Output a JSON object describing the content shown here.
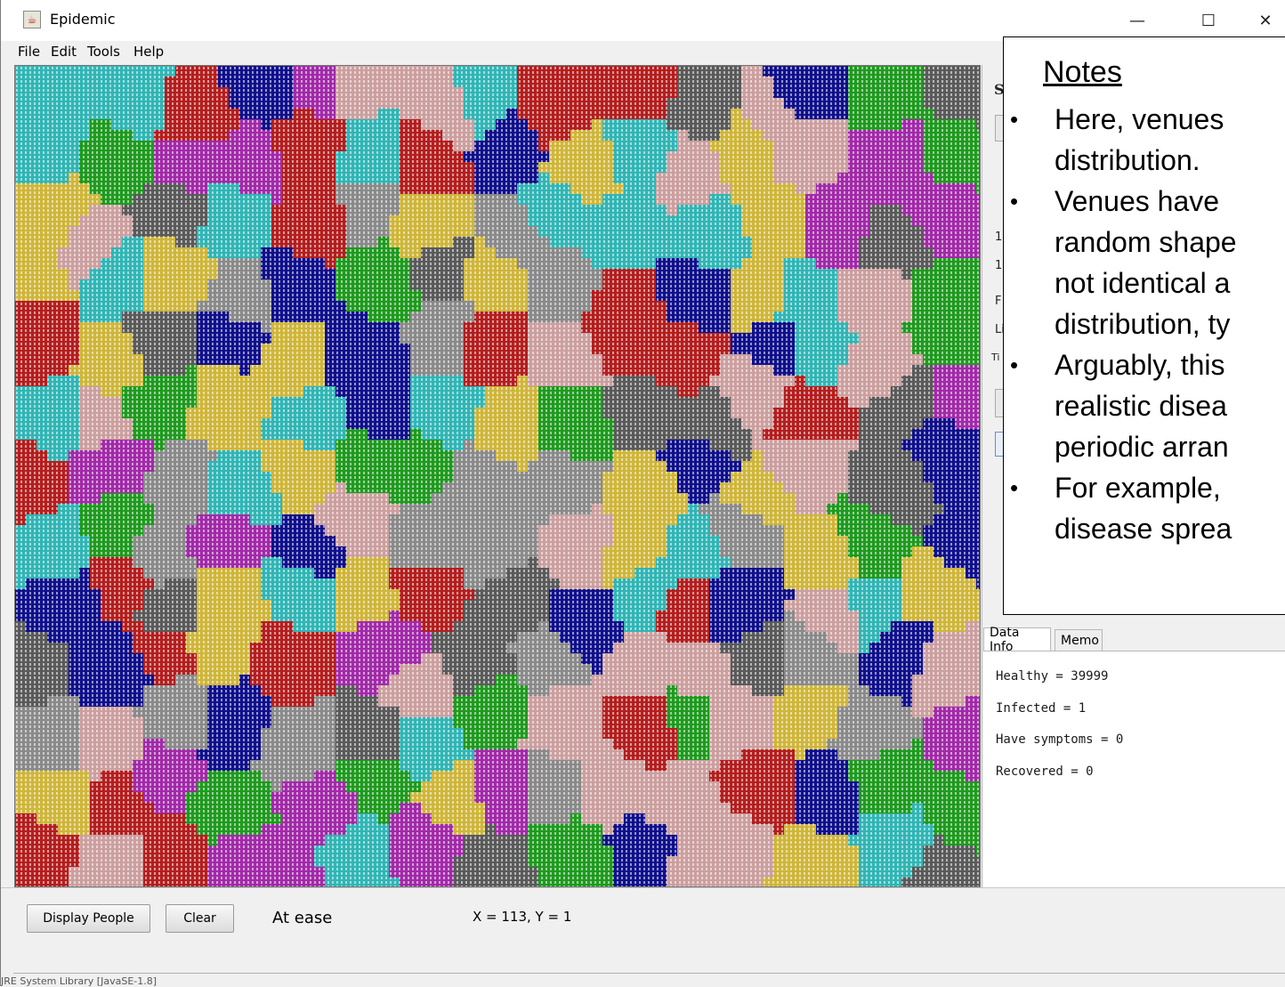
{
  "window": {
    "title": "Epidemic",
    "icon": "java-cup-icon",
    "controls": {
      "minimize": "—",
      "maximize": "☐",
      "close": "✕"
    }
  },
  "menu": {
    "items": [
      "File",
      "Edit",
      "Tools",
      "Help"
    ]
  },
  "grid": {
    "palette": [
      "#b41e1e",
      "#10108c",
      "#1f9a1f",
      "#a12aa8",
      "#31b5b5",
      "#cfb63a",
      "#cc9f9f",
      "#5a5a5a",
      "#8a8a8a"
    ]
  },
  "right_panel_partial_text": {
    "s": "S",
    "r1": "1,",
    "r2": "1,",
    "f": "F",
    "li": "Li",
    "ti": "Ti"
  },
  "tabs": {
    "data_info": "Data Info",
    "memo": "Memo"
  },
  "data_info": {
    "healthy": "Healthy = 39999",
    "infected": "Infected = 1",
    "symptoms": "Have symptoms = 0",
    "recovered": "Recovered = 0"
  },
  "bottom": {
    "display_people": "Display People",
    "clear": "Clear",
    "status": "At ease",
    "coords": "X = 113, Y = 1"
  },
  "statusbar": {
    "text": "JRE System Library [JavaSE-1.8]"
  },
  "notes": {
    "heading": "Notes",
    "bullet": "•",
    "lines": [
      "Here, venues",
      "distribution.",
      "Venues have",
      "random shape",
      "not identical a",
      "distribution, ty",
      "Arguably, this",
      "realistic disea",
      "periodic arran",
      "For example,",
      "disease sprea"
    ]
  }
}
